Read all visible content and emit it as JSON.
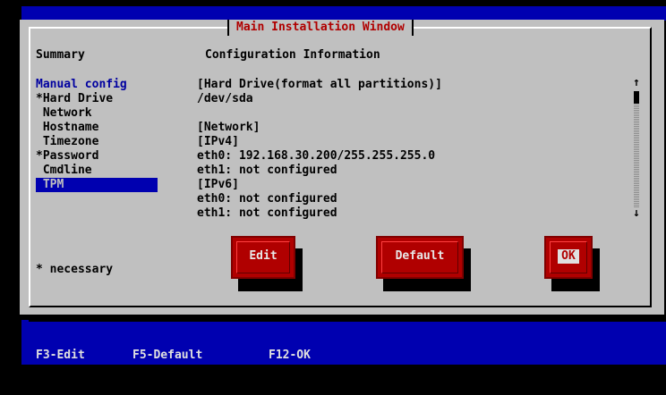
{
  "window": {
    "title": "Main Installation Window"
  },
  "headers": {
    "summary": "Summary",
    "configuration": "Configuration Information"
  },
  "summary": {
    "items": [
      {
        "label": "Manual config"
      },
      {
        "label": "*Hard Drive"
      },
      {
        "label": " Network"
      },
      {
        "label": " Hostname"
      },
      {
        "label": " Timezone"
      },
      {
        "label": "*Password"
      },
      {
        "label": " Cmdline"
      },
      {
        "label": " TPM"
      }
    ],
    "selected_index": 7,
    "note": "* necessary"
  },
  "configuration": {
    "lines": [
      "[Hard Drive(format all partitions)]",
      "/dev/sda",
      "",
      "[Network]",
      "[IPv4]",
      "eth0: 192.168.30.200/255.255.255.0",
      "eth1: not configured",
      "[IPv6]",
      "eth0: not configured",
      "eth1: not configured"
    ]
  },
  "scrollbar": {
    "up_arrow": "↑",
    "down_arrow": "↓"
  },
  "buttons": {
    "edit": "Edit",
    "default": "Default",
    "ok": "OK"
  },
  "function_keys": {
    "f3": "F3-Edit",
    "f5": "F5-Default",
    "f12": "F12-OK"
  },
  "colors": {
    "background": "#000000",
    "dialog": "#c0c0c0",
    "title": "#b00000",
    "highlight": "#0000b0",
    "button": "#b00000"
  }
}
